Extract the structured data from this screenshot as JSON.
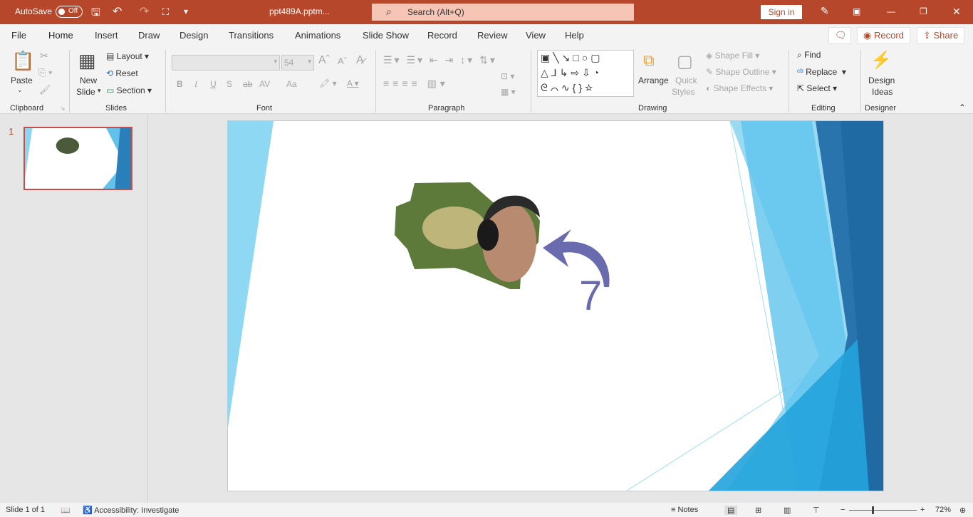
{
  "titlebar": {
    "autosave_label": "AutoSave",
    "autosave_state": "Off",
    "filename": "ppt489A.pptm...",
    "search_placeholder": "Search (Alt+Q)",
    "signin": "Sign in",
    "color": "#b7472a"
  },
  "tabs": [
    "File",
    "Home",
    "Insert",
    "Draw",
    "Design",
    "Transitions",
    "Animations",
    "Slide Show",
    "Record",
    "Review",
    "View",
    "Help"
  ],
  "active_tab": "Home",
  "ribbon_right": {
    "record": "Record",
    "share": "Share"
  },
  "ribbon": {
    "clipboard": {
      "paste": "Paste",
      "group": "Clipboard"
    },
    "slides": {
      "new_slide_1": "New",
      "new_slide_2": "Slide",
      "layout": "Layout",
      "reset": "Reset",
      "section": "Section",
      "group": "Slides"
    },
    "font": {
      "font_name": "",
      "font_size": "54",
      "bold": "B",
      "italic": "I",
      "underline": "U",
      "shadow": "S",
      "strike": "ab",
      "spacing": "AV",
      "case": "Aa",
      "group": "Font"
    },
    "paragraph": {
      "group": "Paragraph"
    },
    "drawing": {
      "arrange": "Arrange",
      "quick_styles_1": "Quick",
      "quick_styles_2": "Styles",
      "shape_fill": "Shape Fill",
      "shape_outline": "Shape Outline",
      "shape_effects": "Shape Effects",
      "group": "Drawing"
    },
    "editing": {
      "find": "Find",
      "replace": "Replace",
      "select": "Select",
      "group": "Editing"
    },
    "designer": {
      "design_ideas_1": "Design",
      "design_ideas_2": "Ideas",
      "group": "Designer"
    }
  },
  "thumbnails": [
    {
      "number": "1"
    }
  ],
  "slide": {
    "number_text": "7",
    "arrow_color": "#6a6aaf"
  },
  "status": {
    "slide_info": "Slide 1 of 1",
    "accessibility": "Accessibility: Investigate",
    "notes": "Notes",
    "zoom": "72%",
    "zoom_level_percent": 72
  }
}
